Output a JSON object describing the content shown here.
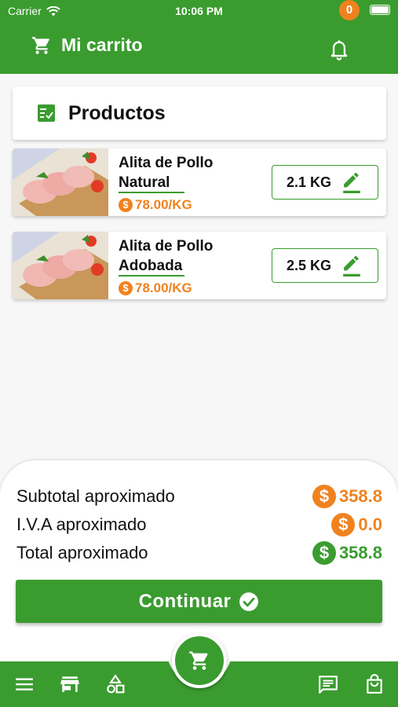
{
  "status_bar": {
    "carrier": "Carrier",
    "time": "10:06 PM"
  },
  "header": {
    "title": "Mi carrito",
    "notification_count": "0"
  },
  "section": {
    "title": "Productos"
  },
  "products": [
    {
      "name": "Alita de Pollo\nNatural",
      "price": "78.00/KG",
      "quantity": "2.1 KG"
    },
    {
      "name": "Alita de Pollo\nAdobada",
      "price": "78.00/KG",
      "quantity": "2.5 KG"
    }
  ],
  "summary": {
    "subtotal_label": "Subtotal aproximado",
    "subtotal_value": "358.8",
    "iva_label": "I.V.A aproximado",
    "iva_value": "0.0",
    "total_label": "Total aproximado",
    "total_value": "358.8",
    "currency_symbol": "$",
    "continue_label": "Continuar"
  },
  "colors": {
    "primary": "#3a9c2f",
    "accent": "#f0821e"
  },
  "icons": {
    "header": "cart-icon",
    "notifications": "bell-icon",
    "section": "checklist-icon",
    "edit": "pencil-icon",
    "nav": [
      "menu-icon",
      "store-icon",
      "categories-icon",
      "cart-icon",
      "chat-icon",
      "bag-icon"
    ]
  }
}
